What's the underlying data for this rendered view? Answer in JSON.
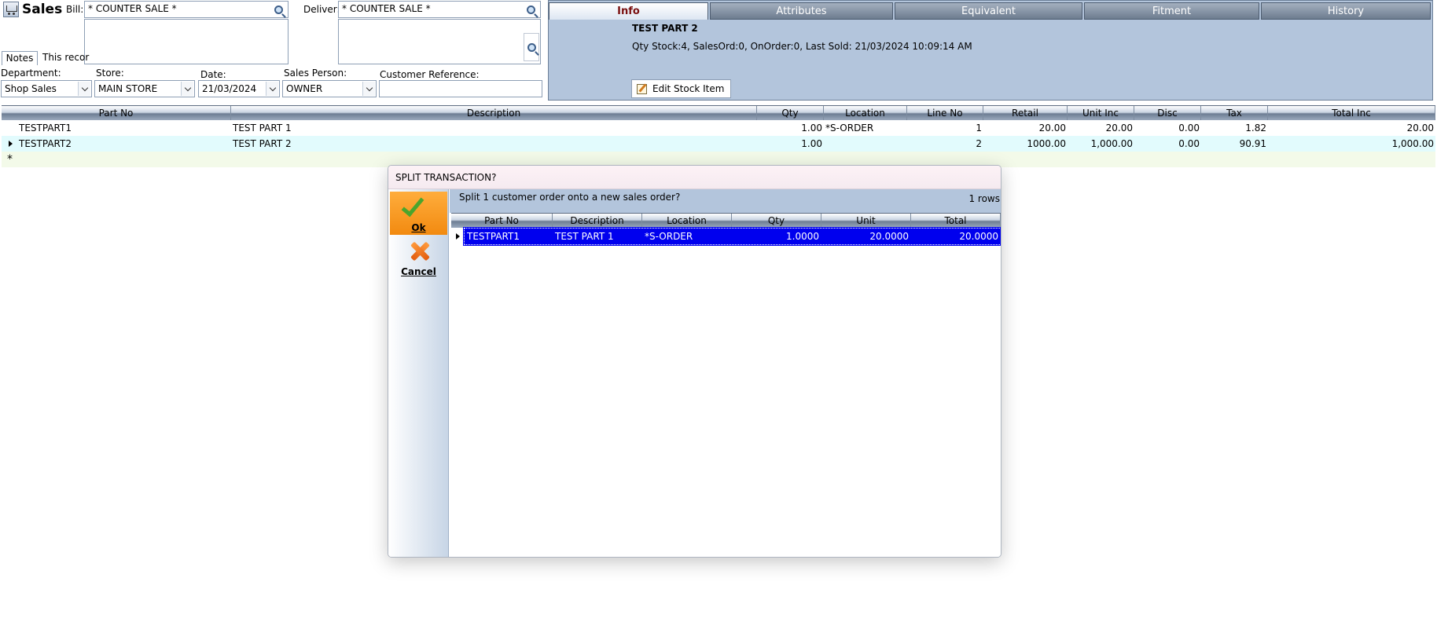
{
  "app": {
    "title": "Sales"
  },
  "form": {
    "bill_label": "Bill:",
    "bill_value": "* COUNTER SALE *",
    "deliver_label": "Deliver:",
    "deliver_value": "* COUNTER SALE *",
    "notes_tab": "Notes",
    "notes_text": "This recor",
    "department_label": "Department:",
    "department_value": "Shop Sales",
    "store_label": "Store:",
    "store_value": "MAIN STORE",
    "date_label": "Date:",
    "date_value": "21/03/2024",
    "salesperson_label": "Sales Person:",
    "salesperson_value": "OWNER",
    "custref_label": "Customer Reference:",
    "custref_value": ""
  },
  "info": {
    "tabs": [
      "Info",
      "Attributes",
      "Equivalent",
      "Fitment",
      "History"
    ],
    "title": "TEST PART 2",
    "line": "Qty Stock:4, SalesOrd:0, OnOrder:0, Last Sold: 21/03/2024 10:09:14 AM",
    "edit_button": "Edit Stock Item"
  },
  "grid": {
    "columns": [
      "Part No",
      "Description",
      "Qty",
      "Location",
      "Line No",
      "Retail",
      "Unit Inc",
      "Disc",
      "Tax",
      "Total Inc"
    ],
    "rows": [
      [
        "TESTPART1",
        "TEST PART 1",
        "1.00",
        "*S-ORDER",
        "1",
        "20.00",
        "20.00",
        "0.00",
        "1.82",
        "20.00"
      ],
      [
        "TESTPART2",
        "TEST PART 2",
        "1.00",
        "",
        "2",
        "1000.00",
        "1,000.00",
        "0.00",
        "90.91",
        "1,000.00"
      ]
    ],
    "new_row_marker": "*"
  },
  "modal": {
    "title": "SPLIT TRANSACTION?",
    "ok_label": "Ok",
    "cancel_label": "Cancel",
    "message": "Split 1 customer order onto a new sales order?",
    "row_count": "1 rows",
    "columns": [
      "Part No",
      "Description",
      "Location",
      "Qty",
      "Unit",
      "Total"
    ],
    "rows": [
      [
        "TESTPART1",
        "TEST PART 1",
        "*S-ORDER",
        "1.0000",
        "20.0000",
        "20.0000"
      ]
    ]
  },
  "colors": {
    "panel_blue": "#b3c5dc",
    "selection_blue": "#0000ee",
    "ok_orange": "#f28a10",
    "active_tab_text": "#7a1010"
  },
  "icons": [
    "sales-app-icon",
    "search-icon",
    "chevron-down-icon",
    "edit-icon",
    "checkmark-icon",
    "cancel-x-icon",
    "row-pointer-icon"
  ]
}
